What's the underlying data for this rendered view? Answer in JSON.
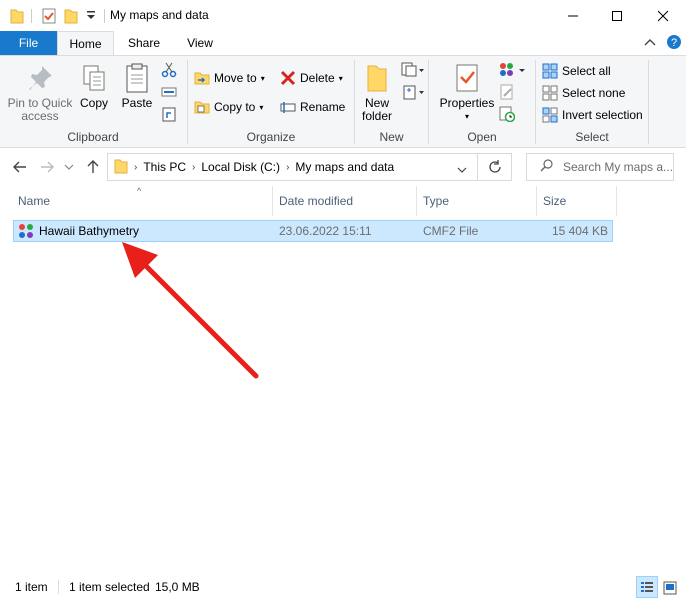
{
  "window": {
    "title": "My maps and data",
    "icons": [
      "folder-icon",
      "properties-check-icon",
      "new-folder-icon",
      "customize-quick-access-icon"
    ],
    "controls": [
      "minimize-icon",
      "maximize-icon",
      "close-icon"
    ]
  },
  "ribbon_tabs": {
    "file": "File",
    "home": "Home",
    "share": "Share",
    "view": "View"
  },
  "clipboard": {
    "pin_label": "Pin to Quick access",
    "copy_label": "Copy",
    "paste_label": "Paste",
    "group_label": "Clipboard"
  },
  "organize": {
    "move_to_label": "Move to",
    "copy_to_label": "Copy to",
    "delete_label": "Delete",
    "rename_label": "Rename",
    "group_label": "Organize"
  },
  "new_group": {
    "new_folder_label": "New folder",
    "group_label": "New"
  },
  "open_group": {
    "properties_label": "Properties",
    "group_label": "Open"
  },
  "select_group": {
    "select_all_label": "Select all",
    "select_none_label": "Select none",
    "invert_label": "Invert selection",
    "group_label": "Select"
  },
  "address": {
    "crumbs": [
      "This PC",
      "Local Disk (C:)",
      "My maps and data"
    ],
    "search_placeholder": "Search My maps a..."
  },
  "columns": {
    "name": "Name",
    "date": "Date modified",
    "type": "Type",
    "size": "Size"
  },
  "files": [
    {
      "name": "Hawaii Bathymetry",
      "date": "23.06.2022 15:11",
      "type": "CMF2 File",
      "size": "15 404 KB",
      "selected": true
    }
  ],
  "status": {
    "count": "1 item",
    "selected": "1 item selected",
    "selected_size": "15,0 MB"
  },
  "colors": {
    "accent": "#1979ca",
    "selection": "#cce8ff",
    "arrow": "#e8201a"
  }
}
